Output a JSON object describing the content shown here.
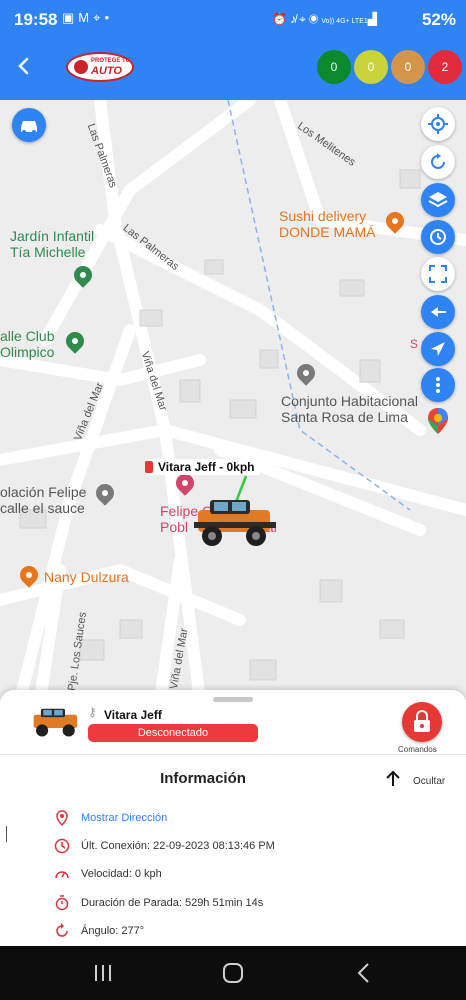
{
  "status_bar": {
    "time": "19:58",
    "left_icons": [
      "image-icon",
      "gmail-icon",
      "location-icon",
      "dot-icon"
    ],
    "right_icons": [
      "alarm-icon",
      "mute-icon",
      "location-icon",
      "hotspot-icon",
      "volte-icon",
      "signal-icon"
    ],
    "network": "Vo)) 4G+ LTE1",
    "battery": "52%"
  },
  "header": {
    "logo_line1": "PROTEGE TU",
    "logo_line2": "AUTO",
    "counters": [
      {
        "value": "0",
        "color": "#0a8a2a"
      },
      {
        "value": "0",
        "color": "#c8d43a"
      },
      {
        "value": "0",
        "color": "#d4954a"
      },
      {
        "value": "2",
        "color": "#e12b3a"
      }
    ]
  },
  "map": {
    "streets": [
      "Las Palmeras",
      "Los Melitenes",
      "Las Palmeras",
      "Viña del Mar",
      "Viña del Mar",
      "Pje. Los Sauces",
      "Viña del Mar"
    ],
    "pois": {
      "jardin_line1": "Jardín Infantil",
      "jardin_line2": "Tía Michelle",
      "sushi_line1": "Sushi delivery",
      "sushi_line2": "DONDE MAMÁ",
      "club_line1": "alle Club",
      "club_line2": "Olimpico",
      "conjunto_line1": "Conjunto Habitacional",
      "conjunto_line2": "Santa Rosa de Lima",
      "escuela_line1": "olación Felipe",
      "escuela_line2": "calle el sauce",
      "felipe_line1": "Felipe C",
      "felipe_line2": "Pobl",
      "felipe_line3": "tal",
      "nany": "Nany Dulzura",
      "edge_label": "S   xp"
    },
    "vehicle_label": "Vitara Jeff - 0kph"
  },
  "sheet": {
    "vehicle_name": "Vitara Jeff",
    "status_badge": "Desconectado",
    "commands_label": "Comandos",
    "info_title": "Información",
    "hide_label": "Ocultar",
    "show_address": "Mostrar Dirección",
    "last_connection": "Últ. Conexión: 22-09-2023 08:13:46 PM",
    "speed": "Velocidad: 0 kph",
    "stop_duration": "Duración de Parada: 529h 51min 14s",
    "angle": "Ángulo: 277°"
  },
  "colors": {
    "primary": "#2f83f2",
    "danger": "#ee3a3e",
    "map_bg": "#ededed"
  }
}
